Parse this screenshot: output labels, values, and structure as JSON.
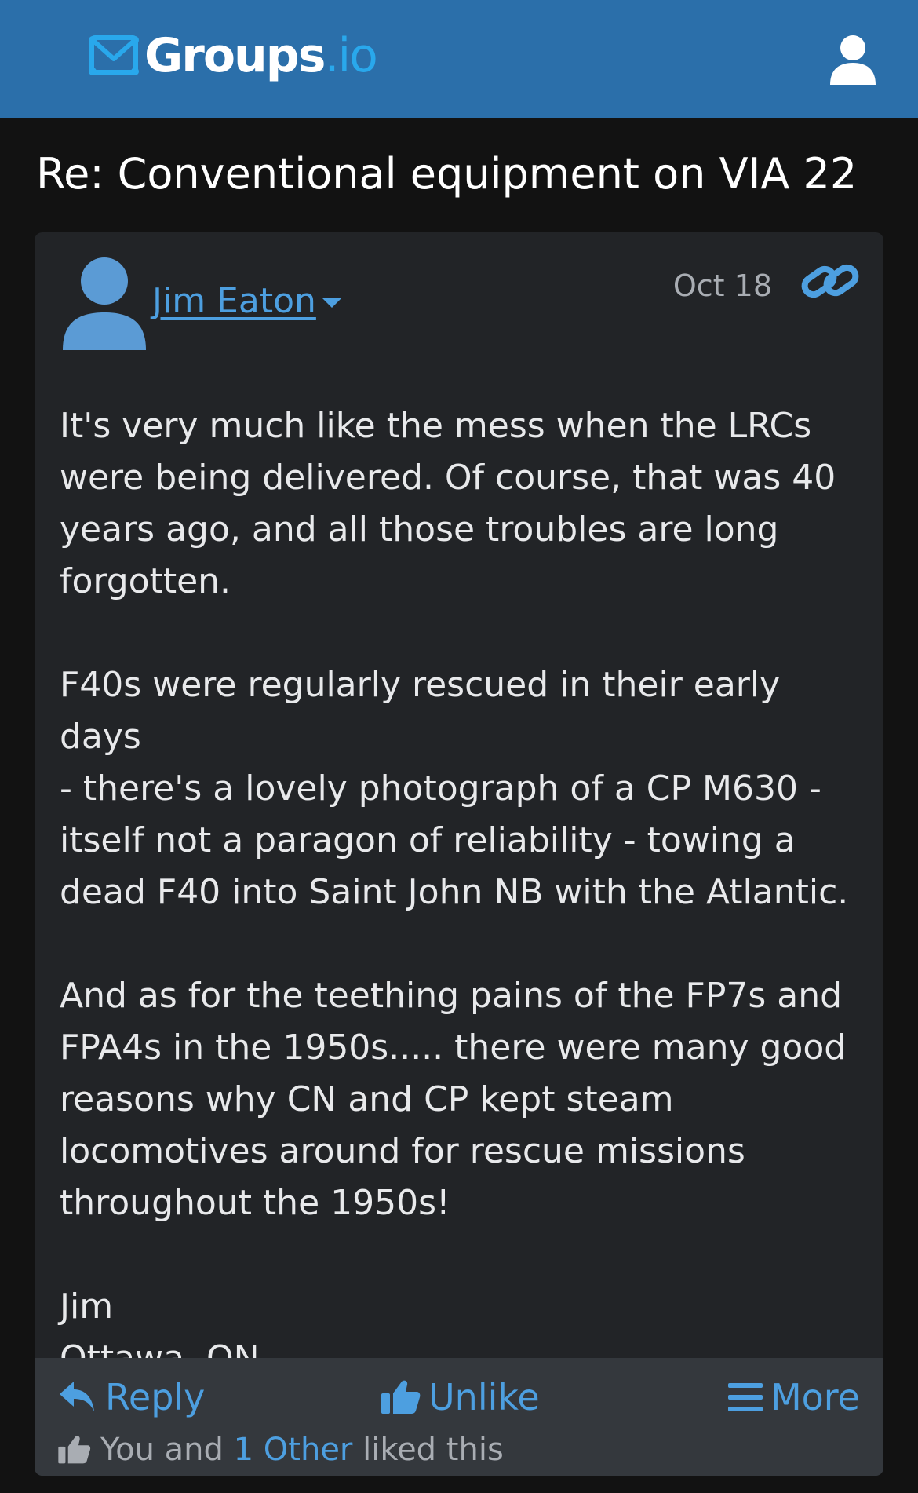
{
  "header": {
    "logo_main": "Groups",
    "logo_suffix": ".io"
  },
  "topic": {
    "title": "Re: Conventional equipment on VIA 22"
  },
  "message": {
    "author": "Jim Eaton",
    "date": "Oct 18",
    "paragraphs": [
      "It's very much like the mess when the LRCs\nwere being delivered.  Of course, that was 40\nyears ago, and all those troubles are long\nforgotten.",
      "F40s were regularly rescued in their early days\n- there's a lovely photograph of a CP M630 -\nitself not a paragon of reliability - towing a\ndead F40 into Saint John NB with the Atlantic.",
      "And as for the teething pains of the FP7s and\nFPA4s in the 1950s..... there were many good\nreasons why CN and CP kept steam\nlocomotives around for rescue missions\nthroughout the 1950s!",
      "Jim\nOttawa, ON"
    ]
  },
  "actions": {
    "reply": "Reply",
    "unlike": "Unlike",
    "more": "More"
  },
  "likes": {
    "prefix": "You and",
    "others": "1 Other",
    "suffix": "liked this"
  },
  "icons": {
    "logo": "envelope-logo-icon",
    "user": "user-icon",
    "avatar": "avatar-icon",
    "link": "link-icon",
    "reply": "reply-arrow-icon",
    "unlike": "thumbs-up-icon",
    "more": "hamburger-icon",
    "likes": "thumbs-up-icon"
  },
  "colors": {
    "navbar": "#2b6faa",
    "accent": "#4d9fe0",
    "card": "#222427",
    "footer": "#34383d",
    "page": "#121212"
  }
}
